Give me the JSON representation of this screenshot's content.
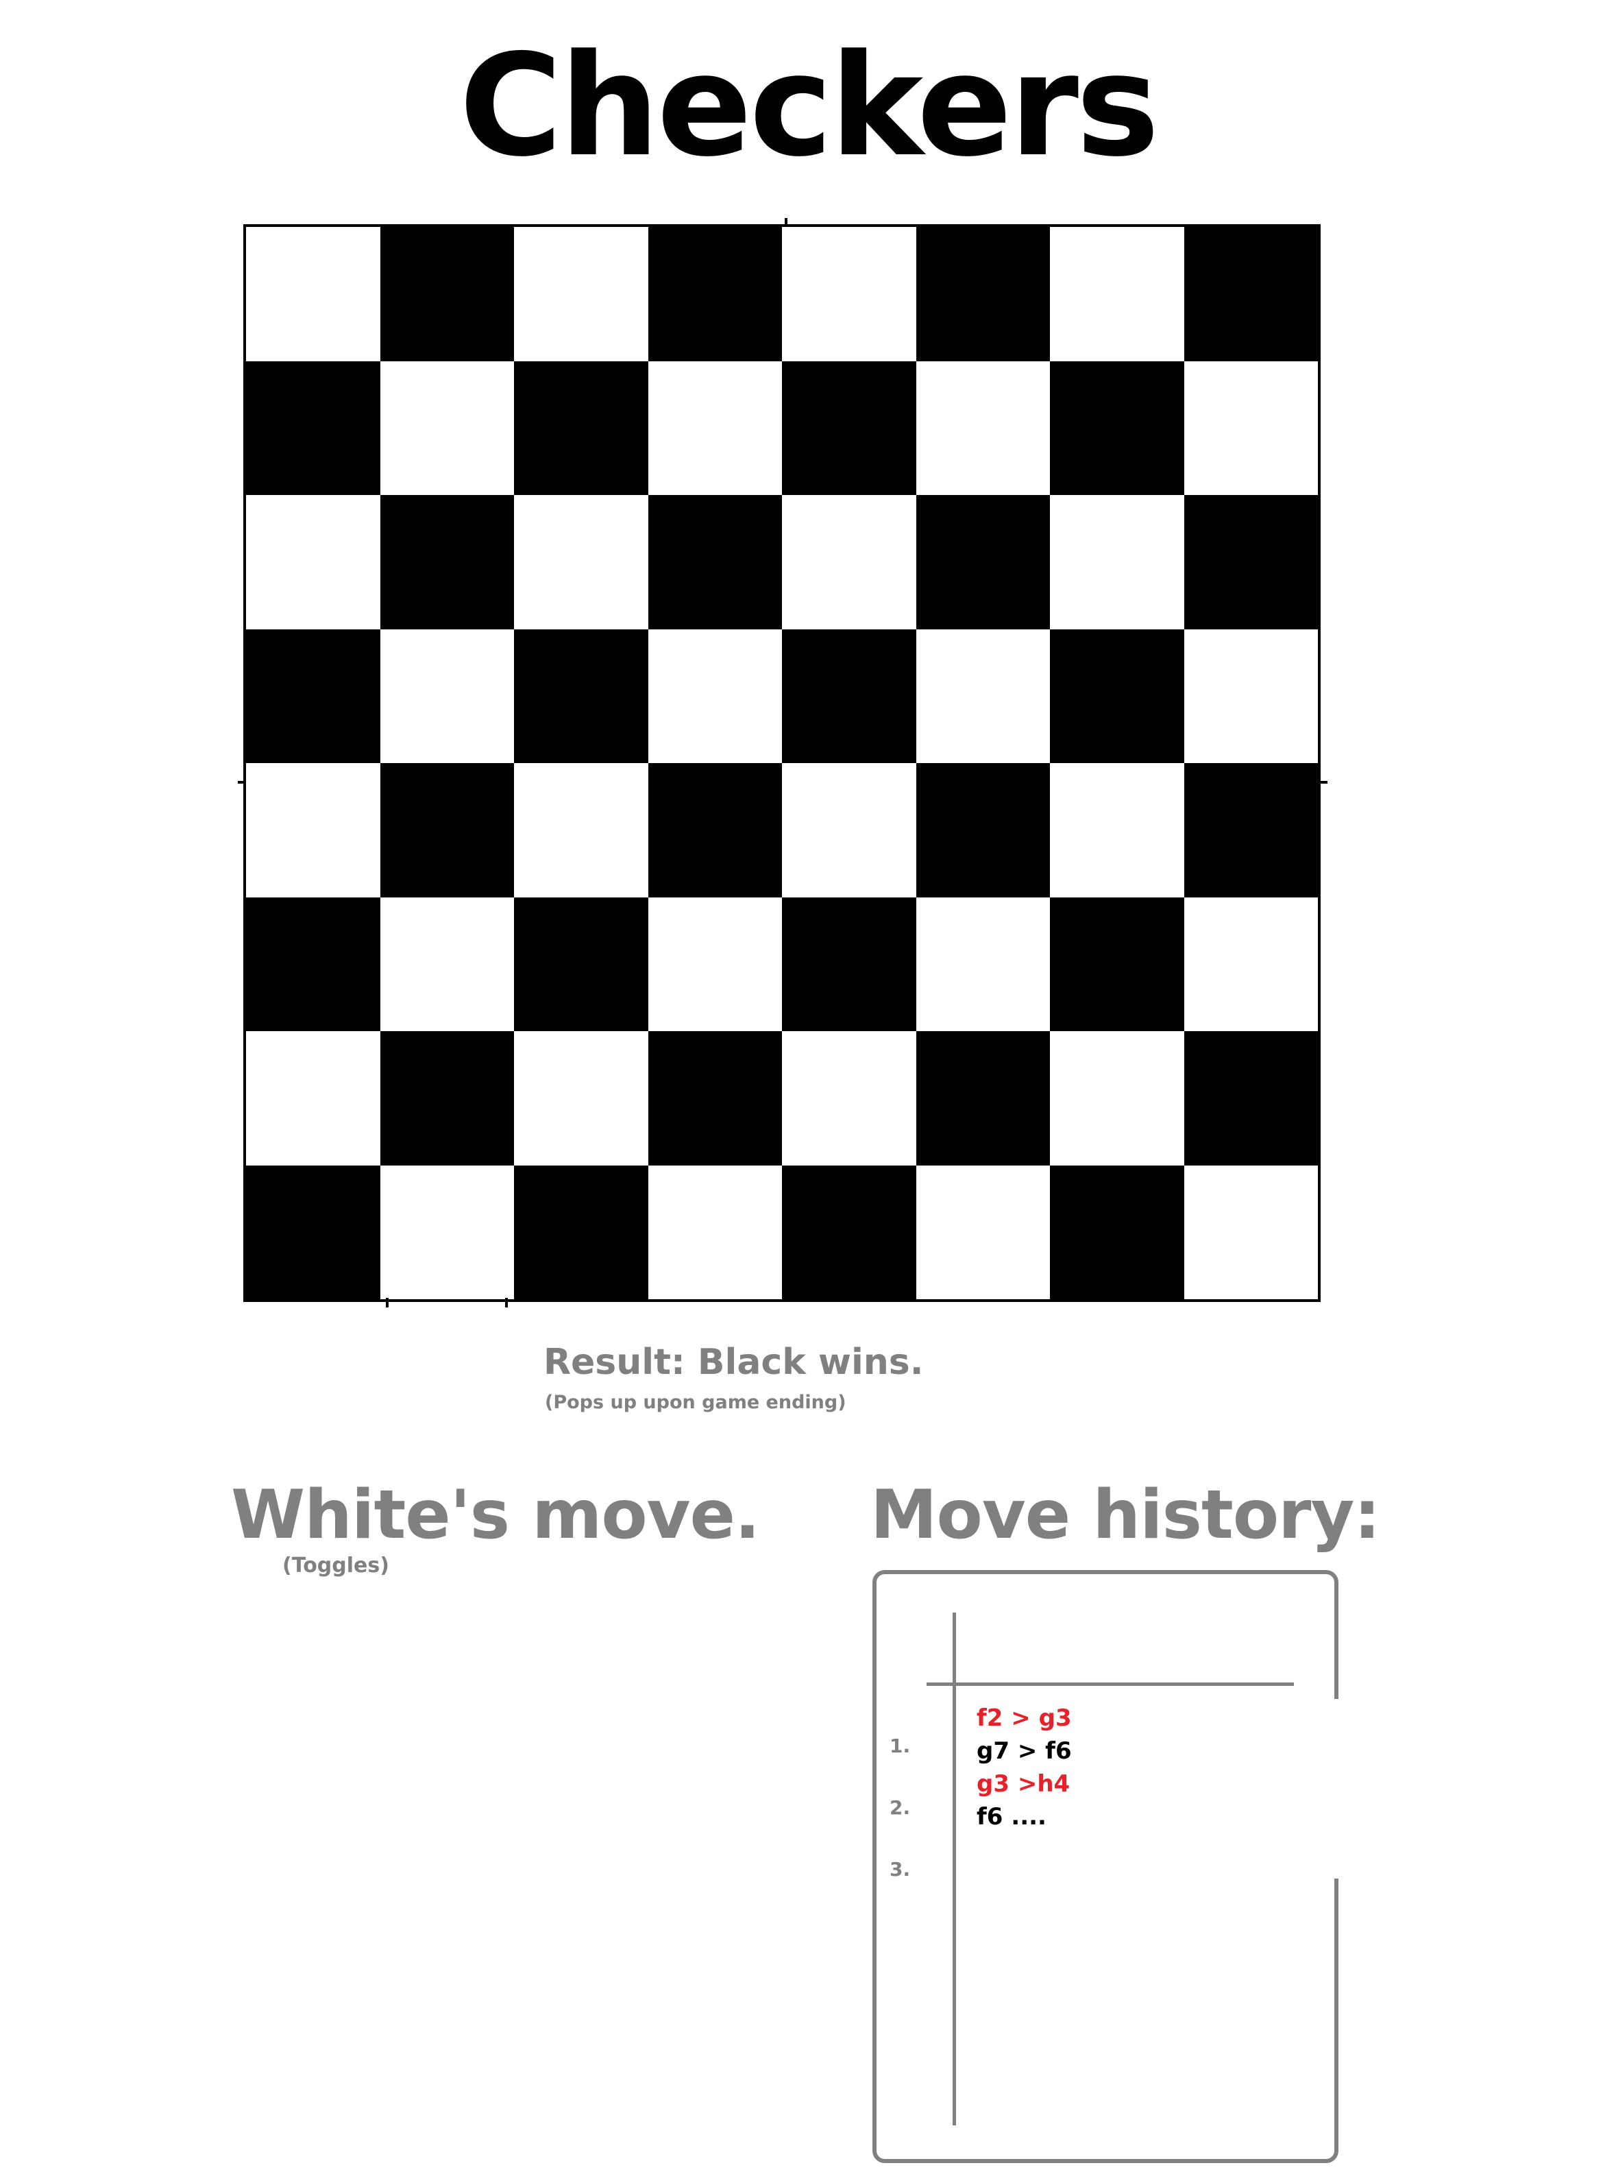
{
  "title": "Checkers",
  "board": {
    "rows": 8,
    "cols": 8,
    "top_left_color": "light",
    "dark_color": "#000000",
    "light_color": "#ffffff"
  },
  "result": {
    "text": "Result: Black wins.",
    "note": "(Pops up upon game ending)"
  },
  "turn": {
    "text": "White's move.",
    "note": "(Toggles)"
  },
  "move_history": {
    "heading": "Move history:",
    "numbers": [
      "1.",
      "2.",
      "3."
    ],
    "moves": [
      {
        "text": "f2 > g3",
        "color": "red"
      },
      {
        "text": "g7 > f6",
        "color": "black"
      },
      {
        "text": "g3 >h4",
        "color": "red"
      },
      {
        "text": "f6 ....",
        "color": "black"
      }
    ]
  },
  "colors": {
    "red_move": "#e8202a",
    "black_move": "#000000",
    "label_gray": "#808080"
  }
}
